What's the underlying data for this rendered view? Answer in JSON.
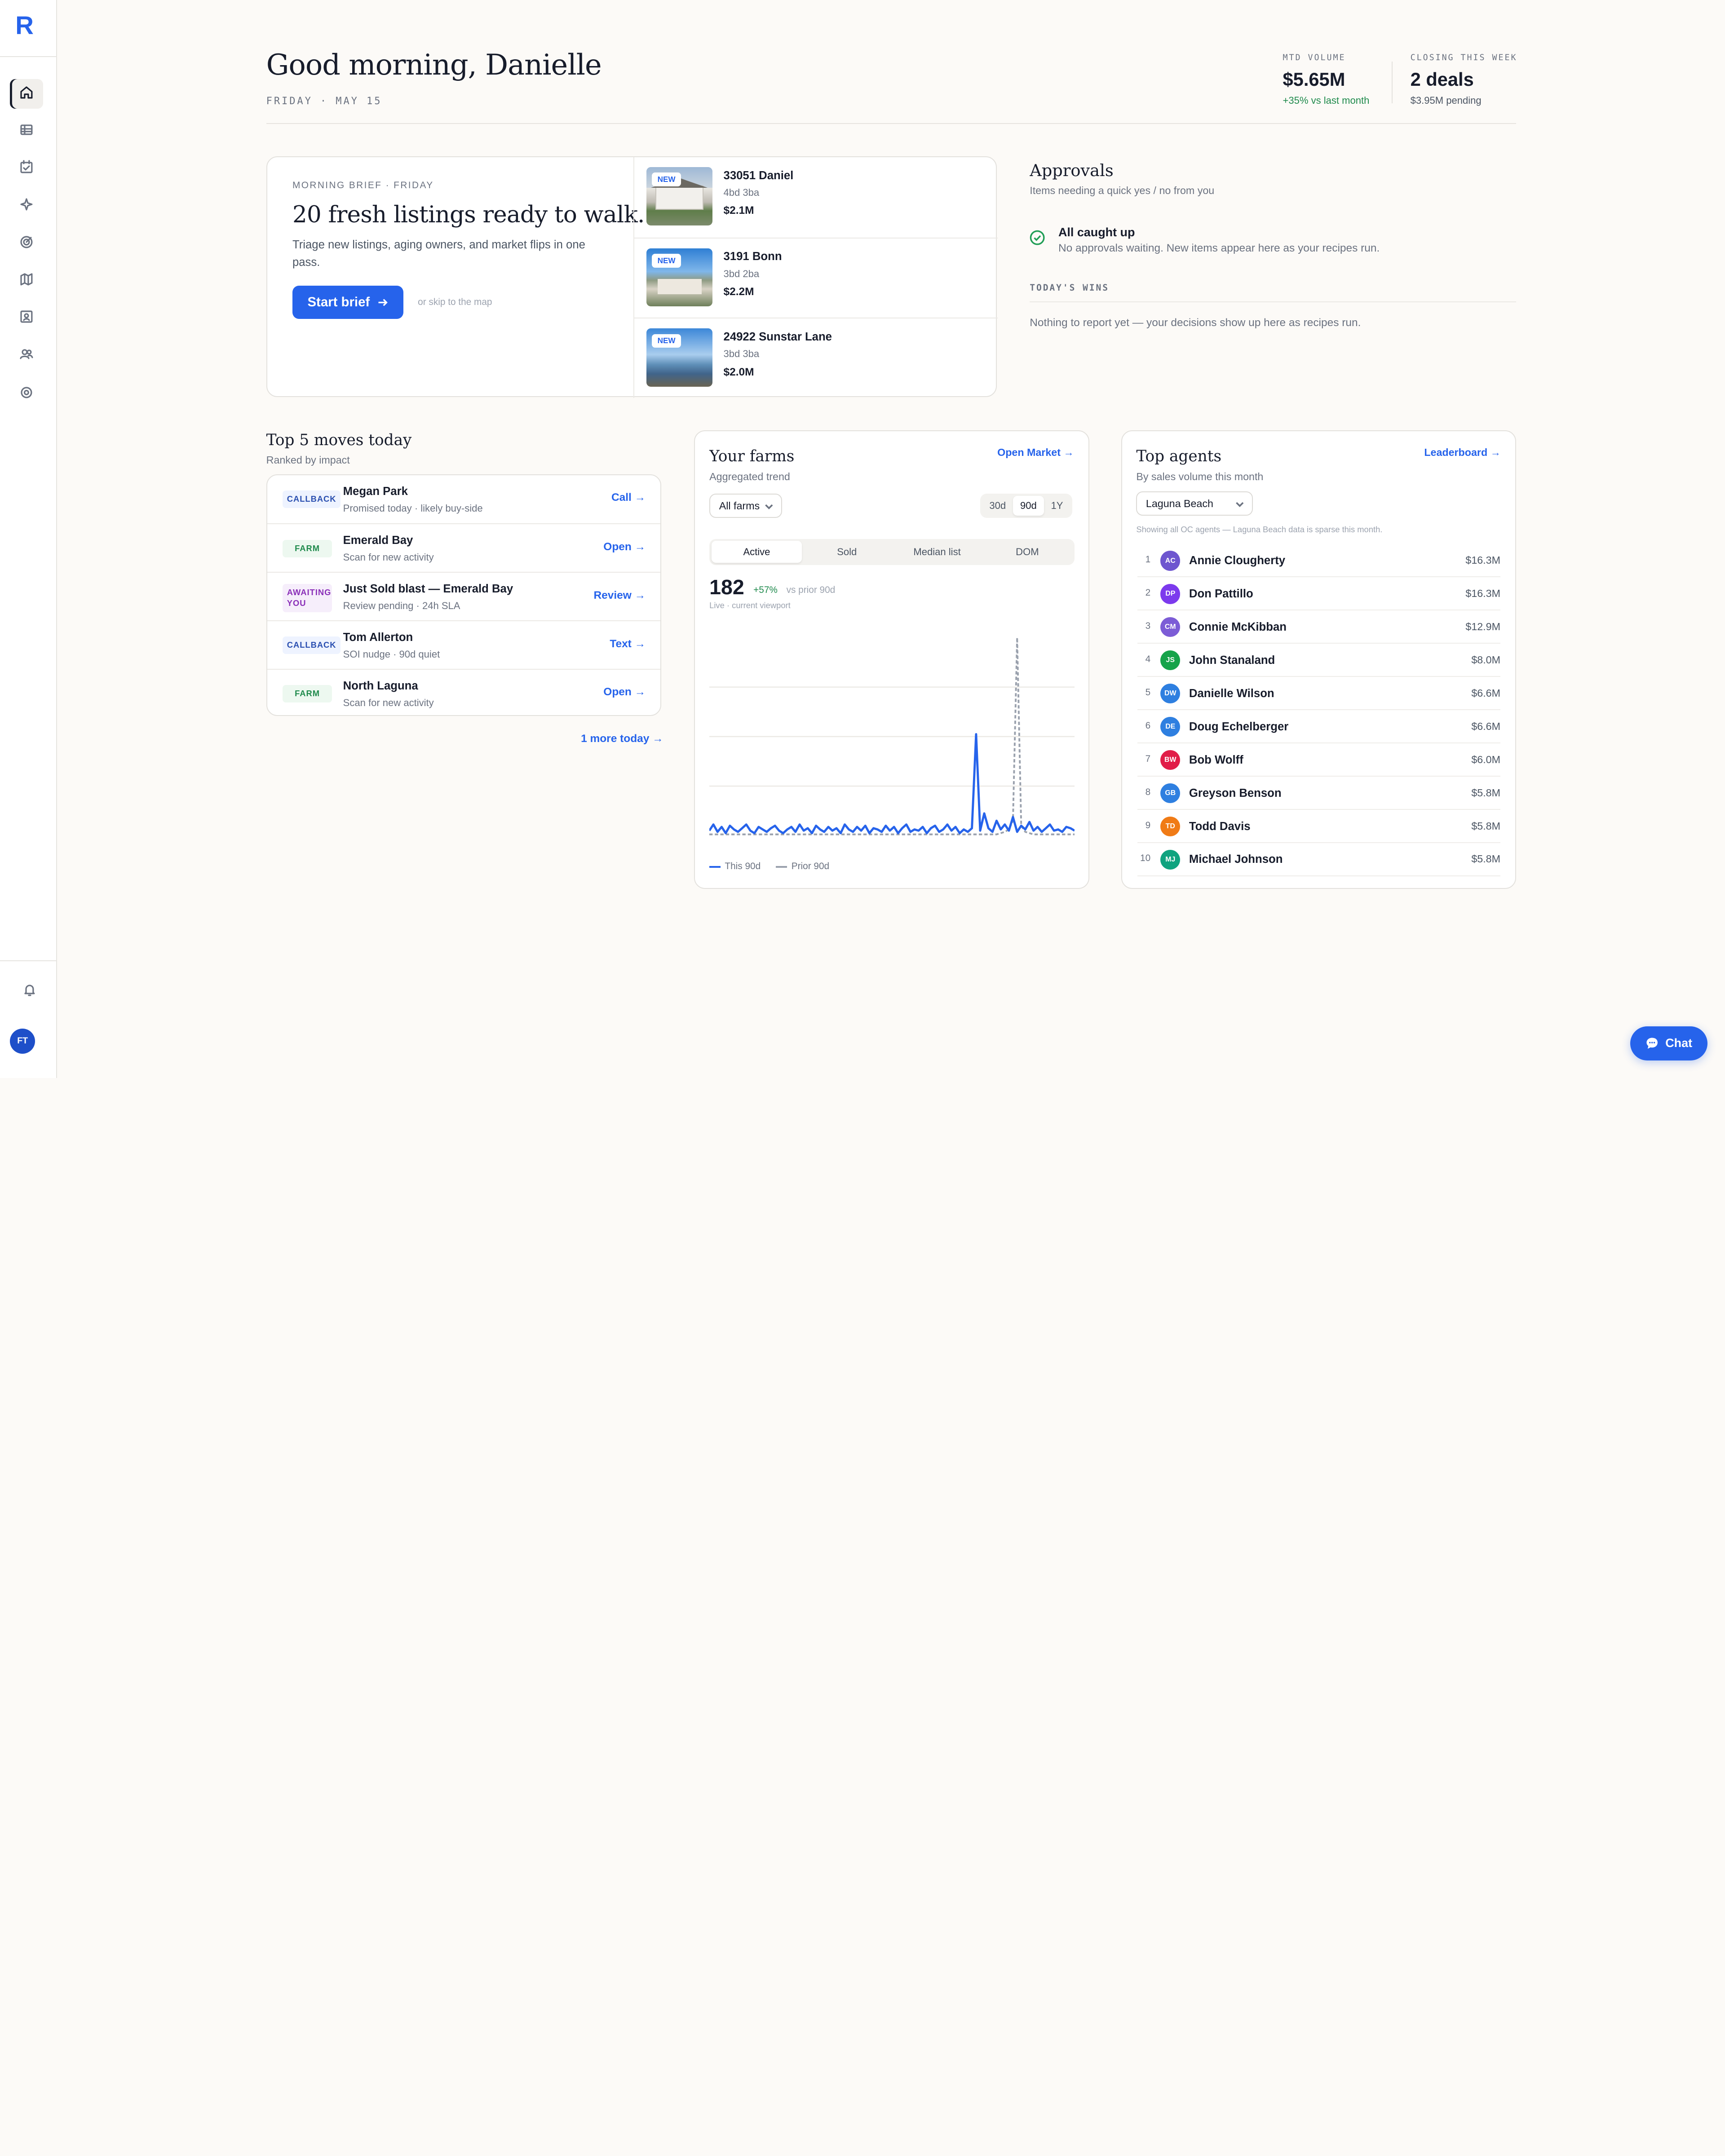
{
  "app": {
    "logo": "R",
    "user_initials": "FT"
  },
  "header": {
    "greeting": "Good morning, Danielle",
    "date": "FRIDAY · MAY 15",
    "stats": [
      {
        "label": "MTD VOLUME",
        "value": "$5.65M",
        "sub": "+35% vs last month",
        "sub_color": "#1f8a4c"
      },
      {
        "label": "CLOSING THIS WEEK",
        "value": "2 deals",
        "sub": "$3.95M pending",
        "sub_color": "#4b5563"
      }
    ]
  },
  "brief": {
    "kicker": "MORNING BRIEF · FRIDAY",
    "title": "20 fresh listings ready to walk.",
    "description": "Triage new listings, aging owners, and market flips in one pass.",
    "cta": "Start brief",
    "skip": "or skip to the map",
    "listings": [
      {
        "badge": "NEW",
        "address": "33051 Daniel",
        "beds": "4bd 3ba",
        "price": "$2.1M"
      },
      {
        "badge": "NEW",
        "address": "3191 Bonn",
        "beds": "3bd 2ba",
        "price": "$2.2M"
      },
      {
        "badge": "NEW",
        "address": "24922 Sunstar Lane",
        "beds": "3bd 3ba",
        "price": "$2.0M"
      }
    ]
  },
  "approvals": {
    "title": "Approvals",
    "subtitle": "Items needing a quick yes / no from you",
    "status_title": "All caught up",
    "status_text": "No approvals waiting. New items appear here as your recipes run.",
    "wins_label": "TODAY'S WINS",
    "wins_text": "Nothing to report yet — your decisions show up here as recipes run."
  },
  "moves": {
    "title": "Top 5 moves today",
    "subtitle": "Ranked by impact",
    "items": [
      {
        "tag": "CALLBACK",
        "kind": "callback",
        "title": "Megan Park",
        "sub": "Promised today · likely buy-side",
        "action": "Call"
      },
      {
        "tag": "FARM",
        "kind": "farm",
        "title": "Emerald Bay",
        "sub": "Scan for new activity",
        "action": "Open"
      },
      {
        "tag": "AWAITING YOU",
        "kind": "awaiting",
        "title": "Just Sold blast — Emerald Bay",
        "sub": "Review pending · 24h SLA",
        "action": "Review"
      },
      {
        "tag": "CALLBACK",
        "kind": "callback",
        "title": "Tom Allerton",
        "sub": "SOI nudge · 90d quiet",
        "action": "Text"
      },
      {
        "tag": "FARM",
        "kind": "farm",
        "title": "North Laguna",
        "sub": "Scan for new activity",
        "action": "Open"
      }
    ],
    "more": "1 more today"
  },
  "farms": {
    "title": "Your farms",
    "subtitle": "Aggregated trend",
    "link": "Open Market",
    "filter": "All farms",
    "ranges": [
      "30d",
      "90d",
      "1Y"
    ],
    "active_range": "90d",
    "tabs": [
      "Active",
      "Sold",
      "Median list",
      "DOM"
    ],
    "active_tab": "Active",
    "metric_value": "182",
    "metric_change": "+57%",
    "metric_compare": "vs prior 90d",
    "metric_note": "Live · current viewport",
    "legend": [
      "This 90d",
      "Prior 90d"
    ]
  },
  "agents": {
    "title": "Top agents",
    "subtitle": "By sales volume this month",
    "link": "Leaderboard",
    "area": "Laguna Beach",
    "note": "Showing all OC agents — Laguna Beach data is sparse this month.",
    "list": [
      {
        "rank": "1",
        "initials": "AC",
        "name": "Annie Clougherty",
        "value": "$16.3M",
        "color": "#6e56cf"
      },
      {
        "rank": "2",
        "initials": "DP",
        "name": "Don Pattillo",
        "value": "$16.3M",
        "color": "#7c3aed"
      },
      {
        "rank": "3",
        "initials": "CM",
        "name": "Connie McKibban",
        "value": "$12.9M",
        "color": "#7c5cd6"
      },
      {
        "rank": "4",
        "initials": "JS",
        "name": "John Stanaland",
        "value": "$8.0M",
        "color": "#16a34a"
      },
      {
        "rank": "5",
        "initials": "DW",
        "name": "Danielle Wilson",
        "value": "$6.6M",
        "color": "#2e7fe0"
      },
      {
        "rank": "6",
        "initials": "DE",
        "name": "Doug Echelberger",
        "value": "$6.6M",
        "color": "#2e7fe0"
      },
      {
        "rank": "7",
        "initials": "BW",
        "name": "Bob Wolff",
        "value": "$6.0M",
        "color": "#e11d48"
      },
      {
        "rank": "8",
        "initials": "GB",
        "name": "Greyson Benson",
        "value": "$5.8M",
        "color": "#2e7fe0"
      },
      {
        "rank": "9",
        "initials": "TD",
        "name": "Todd Davis",
        "value": "$5.8M",
        "color": "#f07b16"
      },
      {
        "rank": "10",
        "initials": "MJ",
        "name": "Michael Johnson",
        "value": "$5.8M",
        "color": "#10a37f"
      }
    ]
  },
  "chat": {
    "label": "Chat"
  },
  "colors": {
    "accent": "#2663eb",
    "positive": "#1f8a4c"
  },
  "chart_data": {
    "type": "line",
    "series": [
      {
        "name": "This 90d",
        "color": "#2663eb",
        "values": [
          4,
          9,
          3,
          7,
          2,
          8,
          5,
          3,
          6,
          9,
          4,
          2,
          7,
          5,
          3,
          6,
          8,
          4,
          2,
          5,
          7,
          3,
          9,
          4,
          6,
          2,
          8,
          5,
          3,
          7,
          4,
          6,
          2,
          9,
          5,
          3,
          7,
          4,
          8,
          2,
          6,
          5,
          3,
          8,
          4,
          7,
          2,
          6,
          9,
          3,
          5,
          4,
          7,
          2,
          6,
          8,
          3,
          5,
          9,
          4,
          7,
          2,
          5,
          3,
          6,
          82,
          4,
          18,
          6,
          3,
          12,
          5,
          9,
          4,
          15,
          3,
          8,
          5,
          11,
          4,
          7,
          3,
          6,
          9,
          4,
          5,
          3,
          7,
          6,
          4
        ]
      },
      {
        "name": "Prior 90d",
        "color": "#9aa1ad",
        "values": [
          1,
          1,
          1,
          1,
          1,
          1,
          1,
          1,
          1,
          1,
          1,
          1,
          1,
          1,
          1,
          1,
          1,
          1,
          1,
          1,
          1,
          1,
          1,
          1,
          1,
          1,
          1,
          1,
          1,
          1,
          1,
          1,
          1,
          1,
          1,
          1,
          1,
          1,
          1,
          1,
          1,
          1,
          1,
          1,
          1,
          1,
          1,
          1,
          1,
          1,
          1,
          1,
          1,
          1,
          1,
          1,
          1,
          1,
          1,
          1,
          1,
          1,
          1,
          1,
          1,
          1,
          1,
          1,
          1,
          1,
          1,
          2,
          3,
          5,
          12,
          160,
          8,
          3,
          2,
          1,
          1,
          1,
          1,
          1,
          1,
          1,
          1,
          1,
          1,
          1
        ]
      }
    ],
    "ylim": [
      0,
      160
    ],
    "grid": true,
    "legend": "bottom-left"
  }
}
